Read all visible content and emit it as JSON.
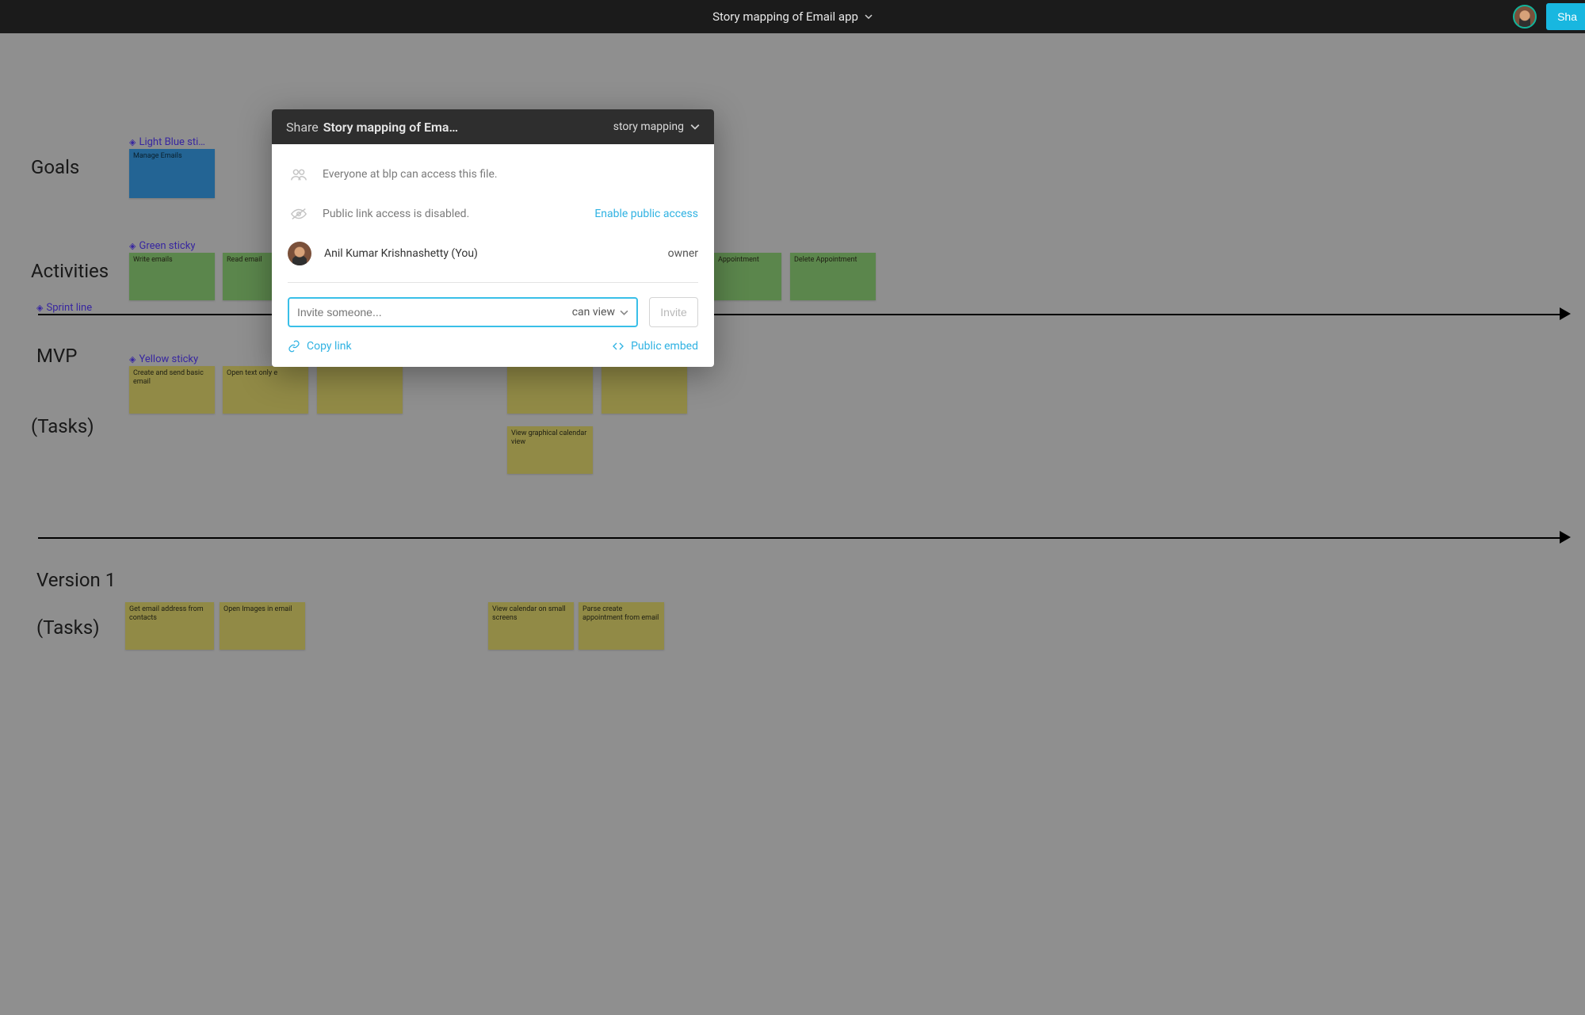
{
  "topbar": {
    "title": "Story mapping of Email app",
    "share_label": "Sha"
  },
  "canvas": {
    "labels": {
      "goals": "Goals",
      "activities": "Activities",
      "mvp": "MVP",
      "tasks1": "(Tasks)",
      "version1": "Version 1",
      "tasks2": "(Tasks)"
    },
    "annotations": {
      "light_blue": "Light Blue sti…",
      "green": "Green sticky",
      "sprint": "Sprint line",
      "yellow": "Yellow sticky"
    },
    "goal_cards": [
      {
        "text": "Manage Emails"
      }
    ],
    "activity_cards": [
      {
        "text": "Write emails"
      },
      {
        "text": "Read email"
      },
      {
        "text": "Appointment"
      },
      {
        "text": "Delete Appointment"
      }
    ],
    "mvp_cards_row1": [
      {
        "text": "Create and send basic email"
      },
      {
        "text": "Open text only e"
      },
      {
        "text": ""
      },
      {
        "text": ""
      },
      {
        "text": ""
      }
    ],
    "mvp_cards_row2": [
      {
        "text": "View graphical calendar view"
      }
    ],
    "v1_cards": [
      {
        "text": "Get email address from contacts"
      },
      {
        "text": "Open Images in email"
      },
      {
        "text": "View calendar on small screens"
      },
      {
        "text": "Parse create appointment from email"
      }
    ]
  },
  "modal": {
    "head_prefix": "Share",
    "head_name": "Story mapping of Ema…",
    "category": "story mapping",
    "org_text": "Everyone at blp can access this file.",
    "public_text": "Public link access is disabled.",
    "enable_public": "Enable public access",
    "user_name": "Anil Kumar Krishnashetty (You)",
    "user_role": "owner",
    "invite_placeholder": "Invite someone...",
    "perm_label": "can view",
    "invite_btn": "Invite",
    "copy_link": "Copy link",
    "public_embed": "Public embed"
  }
}
